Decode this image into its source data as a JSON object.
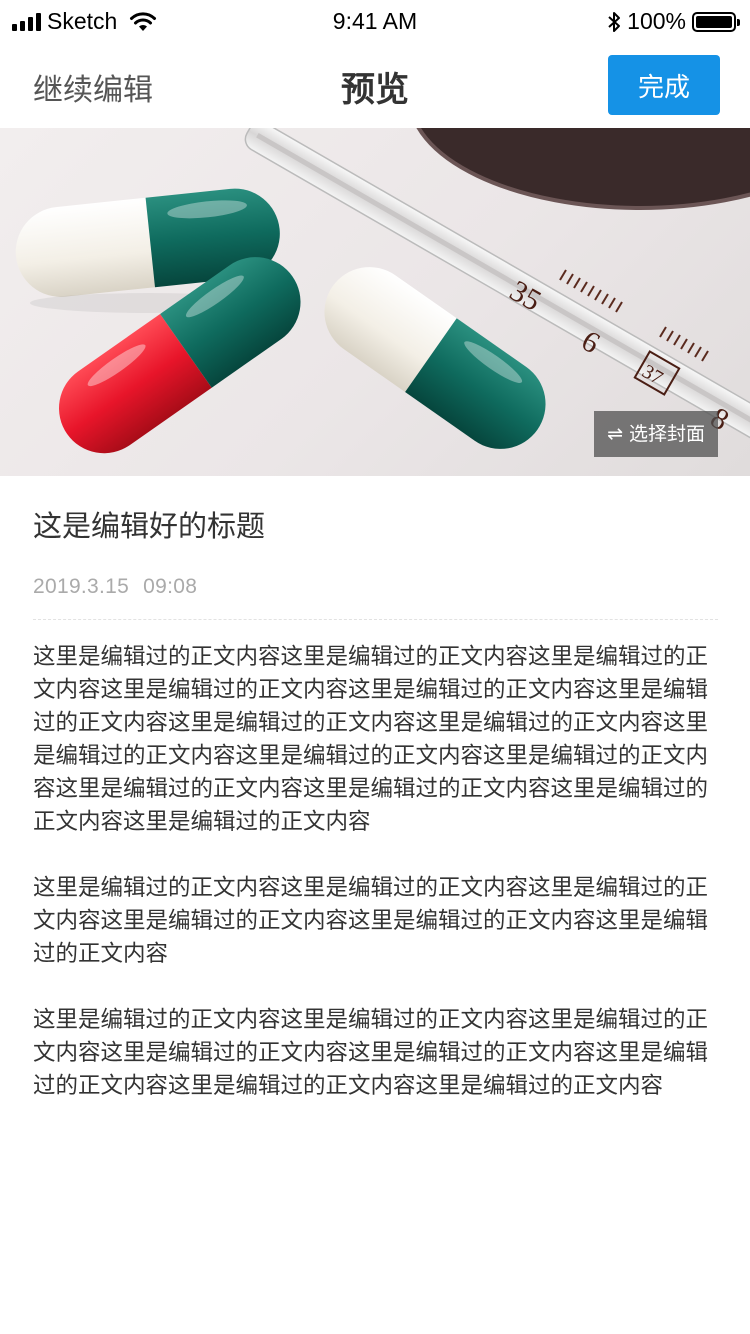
{
  "status_bar": {
    "carrier": "Sketch",
    "time": "9:41 AM",
    "battery": "100%"
  },
  "nav": {
    "back_label": "继续编辑",
    "title": "预览",
    "done_label": "完成"
  },
  "cover": {
    "select_cover_label": "选择封面",
    "thermometer_marks": [
      "35",
      "6",
      "37",
      "8"
    ]
  },
  "article": {
    "title": "这是编辑好的标题",
    "date": "2019.3.15",
    "time": "09:08",
    "paragraphs": [
      "这里是编辑过的正文内容这里是编辑过的正文内容这里是编辑过的正文内容这里是编辑过的正文内容这里是编辑过的正文内容这里是编辑过的正文内容这里是编辑过的正文内容这里是编辑过的正文内容这里是编辑过的正文内容这里是编辑过的正文内容这里是编辑过的正文内容这里是编辑过的正文内容这里是编辑过的正文内容这里是编辑过的正文内容这里是编辑过的正文内容",
      "这里是编辑过的正文内容这里是编辑过的正文内容这里是编辑过的正文内容这里是编辑过的正文内容这里是编辑过的正文内容这里是编辑过的正文内容",
      "这里是编辑过的正文内容这里是编辑过的正文内容这里是编辑过的正文内容这里是编辑过的正文内容这里是编辑过的正文内容这里是编辑过的正文内容这里是编辑过的正文内容这里是编辑过的正文内容"
    ]
  },
  "colors": {
    "accent": "#1592e6",
    "capsule_green": "#0f6b5e",
    "capsule_red": "#e8152a",
    "capsule_white": "#f4f1ea"
  }
}
